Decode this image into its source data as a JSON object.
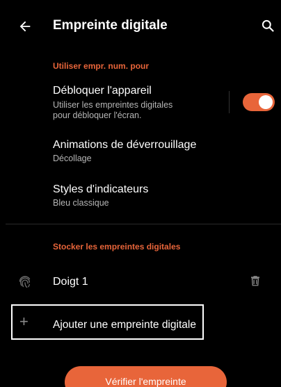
{
  "appbar": {
    "title": "Empreinte digitale",
    "back_icon": "arrow-left-icon",
    "search_icon": "search-icon"
  },
  "section_use": {
    "header": "Utiliser empr. num. pour",
    "unlock": {
      "title": "Débloquer l'appareil",
      "subtitle_line1": "Utiliser les empreintes digitales",
      "subtitle_line2": "pour débloquer l'écran.",
      "toggle_on": true
    },
    "animations": {
      "title": "Animations de déverrouillage",
      "subtitle": "Décollage"
    },
    "indicators": {
      "title": "Styles d'indicateurs",
      "subtitle": "Bleu classique"
    }
  },
  "section_store": {
    "header": "Stocker les empreintes digitales",
    "fingers": [
      {
        "name": "Doigt 1",
        "icon": "fingerprint-icon",
        "delete_icon": "trash-icon"
      }
    ],
    "add_label": "Ajouter une empreinte digitale",
    "add_icon": "plus-icon"
  },
  "verify_button": "Vérifier l'empreinte",
  "colors": {
    "accent": "#e8653a",
    "background": "#000000",
    "text": "#ffffff",
    "subtext": "#b6b6b6"
  }
}
